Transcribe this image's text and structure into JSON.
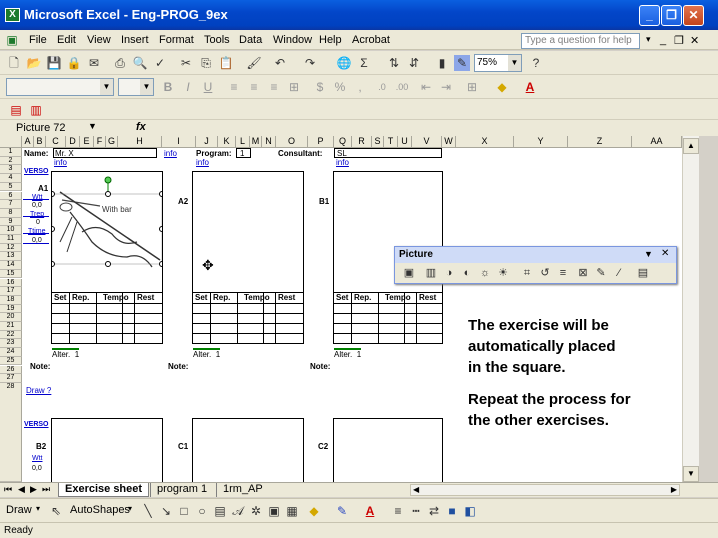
{
  "window": {
    "title": "Microsoft Excel - Eng-PROG_9ex"
  },
  "menu": [
    "File",
    "Edit",
    "View",
    "Insert",
    "Format",
    "Tools",
    "Data",
    "Window",
    "Help",
    "Acrobat"
  ],
  "help_placeholder": "Type a question for help",
  "toolbar": {
    "zoom": "75%"
  },
  "namebox": {
    "value": "Picture 72",
    "fx": "fx"
  },
  "columns": [
    "A",
    "B",
    "C",
    "D",
    "E",
    "F",
    "G",
    "H",
    "I",
    "J",
    "K",
    "L",
    "M",
    "N",
    "O",
    "P",
    "Q",
    "R",
    "S",
    "T",
    "U",
    "V",
    "W",
    "X",
    "Y",
    "Z",
    "AA"
  ],
  "rows": [
    "1",
    "2",
    "3",
    "4",
    "5",
    "6",
    "7",
    "8",
    "9",
    "10",
    "11",
    "12",
    "13",
    "14",
    "15",
    "16",
    "17",
    "18",
    "19",
    "20",
    "21",
    "22",
    "23",
    "24",
    "25",
    "26",
    "27",
    "28"
  ],
  "sheet": {
    "name_label": "Name:",
    "name_value": "Mr. X",
    "info": "info",
    "program_label": "Program:",
    "program_value": "1",
    "consultant_label": "Consultant:",
    "consultant_value": "SL",
    "verso": "VERSO",
    "a1": "A1",
    "a2": "A2",
    "b1": "B1",
    "b2": "B2",
    "c1": "C1",
    "c2": "C2",
    "wtt": "Wtt",
    "trep": "Trep",
    "ttime": "Ttime",
    "v00a": "0,0",
    "v00b": "0,0",
    "v00c": "0,0",
    "v0": "0",
    "set": "Set",
    "rep": "Rep.",
    "tempo": "Tempo",
    "rest": "Rest",
    "alter": "Alter.",
    "alter_val": "1",
    "note": "Note:",
    "draw": "Draw ?",
    "with_bar": "With bar"
  },
  "instructions": {
    "line1": "The exercise will be",
    "line2": "automatically placed",
    "line3": "in the square.",
    "line4": "Repeat the process for",
    "line5": "the other exercises."
  },
  "picture_toolbar": {
    "title": "Picture"
  },
  "sheet_tabs": [
    "Exercise sheet",
    "program 1",
    "1rm_AP"
  ],
  "drawing": {
    "draw": "Draw",
    "autoshapes": "AutoShapes"
  },
  "status": "Ready"
}
